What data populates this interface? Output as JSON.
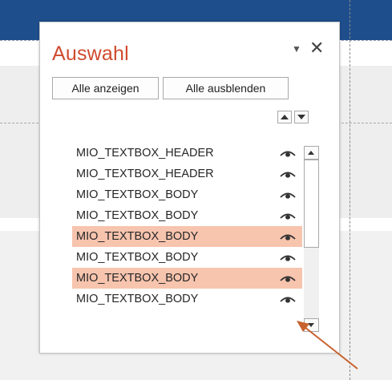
{
  "pane": {
    "title": "Auswahl",
    "menu_icon": "dropdown-triangle-icon",
    "close_glyph": "✕",
    "buttons": {
      "show_all": "Alle anzeigen",
      "hide_all": "Alle ausblenden"
    }
  },
  "items": [
    {
      "label": "MIO_TEXTBOX_HEADER",
      "selected": false
    },
    {
      "label": "MIO_TEXTBOX_HEADER",
      "selected": false
    },
    {
      "label": "MIO_TEXTBOX_BODY",
      "selected": false
    },
    {
      "label": "MIO_TEXTBOX_BODY",
      "selected": false
    },
    {
      "label": "MIO_TEXTBOX_BODY",
      "selected": true
    },
    {
      "label": "MIO_TEXTBOX_BODY",
      "selected": false
    },
    {
      "label": "MIO_TEXTBOX_BODY",
      "selected": true
    },
    {
      "label": "MIO_TEXTBOX_BODY",
      "selected": false
    }
  ],
  "colors": {
    "title": "#d04a2e",
    "selected_row": "#f7c4ae",
    "top_bar": "#1f4e8d",
    "annotation_arrow": "#c8622e"
  },
  "icons": {
    "visibility": "eye-icon",
    "move_up": "bring-forward-icon",
    "move_down": "send-backward-icon",
    "scroll_up": "scroll-up-icon",
    "scroll_down": "scroll-down-icon"
  }
}
